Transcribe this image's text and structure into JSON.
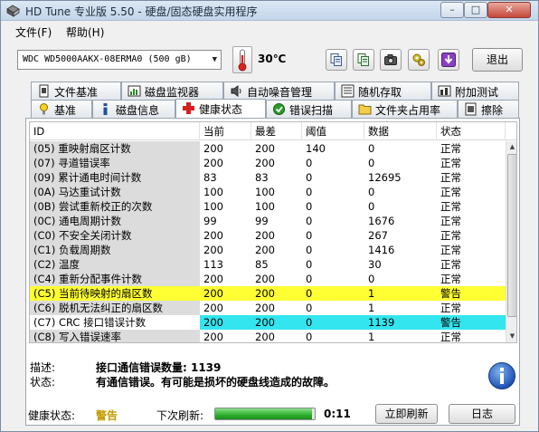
{
  "window": {
    "title": "HD Tune 专业版 5.50 - 硬盘/固态硬盘实用程序",
    "controls": [
      "–",
      "□",
      "✕"
    ]
  },
  "menu": [
    {
      "label": "文件(F)"
    },
    {
      "label": "帮助(H)"
    }
  ],
  "toolbar": {
    "drive": "WDC WD5000AAKX-08ERMA0 (500 gB)",
    "temperature": "30℃",
    "buttons": [
      {
        "icon": "copy-icon"
      },
      {
        "icon": "copy-all-icon"
      },
      {
        "icon": "camera-icon"
      },
      {
        "icon": "options-icon"
      },
      {
        "icon": "download-icon"
      }
    ],
    "exit_label": "退出"
  },
  "tabs_row1": [
    {
      "label": "文件基准",
      "icon": "file-benchmark-icon"
    },
    {
      "label": "磁盘监视器",
      "icon": "disk-monitor-icon"
    },
    {
      "label": "自动噪音管理",
      "icon": "speaker-icon"
    },
    {
      "label": "随机存取",
      "icon": "random-access-icon"
    },
    {
      "label": "附加测试",
      "icon": "extra-tests-icon"
    }
  ],
  "tabs_row2": [
    {
      "label": "基准",
      "icon": "benchmark-icon"
    },
    {
      "label": "磁盘信息",
      "icon": "info-icon"
    },
    {
      "label": "健康状态",
      "icon": "health-cross-icon",
      "active": true
    },
    {
      "label": "错误扫描",
      "icon": "error-scan-icon"
    },
    {
      "label": "文件夹占用率",
      "icon": "folder-icon"
    },
    {
      "label": "擦除",
      "icon": "erase-icon"
    }
  ],
  "health_table": {
    "columns": [
      "ID",
      "当前",
      "最差",
      "阈值",
      "数据",
      "状态"
    ],
    "rows": [
      {
        "id": "(05) 重映射扇区计数",
        "current": "200",
        "worst": "200",
        "threshold": "140",
        "data": "0",
        "status": "正常"
      },
      {
        "id": "(07) 寻道错误率",
        "current": "200",
        "worst": "200",
        "threshold": "0",
        "data": "0",
        "status": "正常"
      },
      {
        "id": "(09) 累计通电时间计数",
        "current": "83",
        "worst": "83",
        "threshold": "0",
        "data": "12695",
        "status": "正常"
      },
      {
        "id": "(0A) 马达重试计数",
        "current": "100",
        "worst": "100",
        "threshold": "0",
        "data": "0",
        "status": "正常"
      },
      {
        "id": "(0B) 尝试重新校正的次数",
        "current": "100",
        "worst": "100",
        "threshold": "0",
        "data": "0",
        "status": "正常"
      },
      {
        "id": "(0C) 通电周期计数",
        "current": "99",
        "worst": "99",
        "threshold": "0",
        "data": "1676",
        "status": "正常"
      },
      {
        "id": "(C0) 不安全关闭计数",
        "current": "200",
        "worst": "200",
        "threshold": "0",
        "data": "267",
        "status": "正常"
      },
      {
        "id": "(C1) 负载周期数",
        "current": "200",
        "worst": "200",
        "threshold": "0",
        "data": "1416",
        "status": "正常"
      },
      {
        "id": "(C2) 温度",
        "current": "113",
        "worst": "85",
        "threshold": "0",
        "data": "30",
        "status": "正常"
      },
      {
        "id": "(C4) 重新分配事件计数",
        "current": "200",
        "worst": "200",
        "threshold": "0",
        "data": "0",
        "status": "正常"
      },
      {
        "id": "(C5) 当前待映射的扇区数",
        "current": "200",
        "worst": "200",
        "threshold": "0",
        "data": "1",
        "status": "警告",
        "highlight": "#ffff33"
      },
      {
        "id": "(C6) 脱机无法纠正的扇区数",
        "current": "200",
        "worst": "200",
        "threshold": "0",
        "data": "1",
        "status": "正常"
      },
      {
        "id": "(C7) CRC 接口错误计数",
        "current": "200",
        "worst": "200",
        "threshold": "0",
        "data": "1139",
        "status": "警告",
        "highlight": "#33e5ee"
      },
      {
        "id": "(C8) 写入错误速率",
        "current": "200",
        "worst": "200",
        "threshold": "0",
        "data": "1",
        "status": "正常"
      }
    ]
  },
  "details": {
    "description_label": "描述:",
    "description_value": "接口通信错误数量:  1139",
    "status_label": "状态:",
    "status_value": "有通信错误。有可能是损坏的硬盘线造成的故障。"
  },
  "footer": {
    "health_label": "健康状态:",
    "health_value": "警告",
    "next_refresh_label": "下次刷新:",
    "progress_fraction": 0.97,
    "countdown": "0:11",
    "refresh_button": "立即刷新",
    "log_button": "日志"
  },
  "colors": {
    "warning_yellow": "#ffff33",
    "warning_cyan": "#33e5ee",
    "warning_text": "#c29b00",
    "progress_green": "#2faf2f"
  }
}
